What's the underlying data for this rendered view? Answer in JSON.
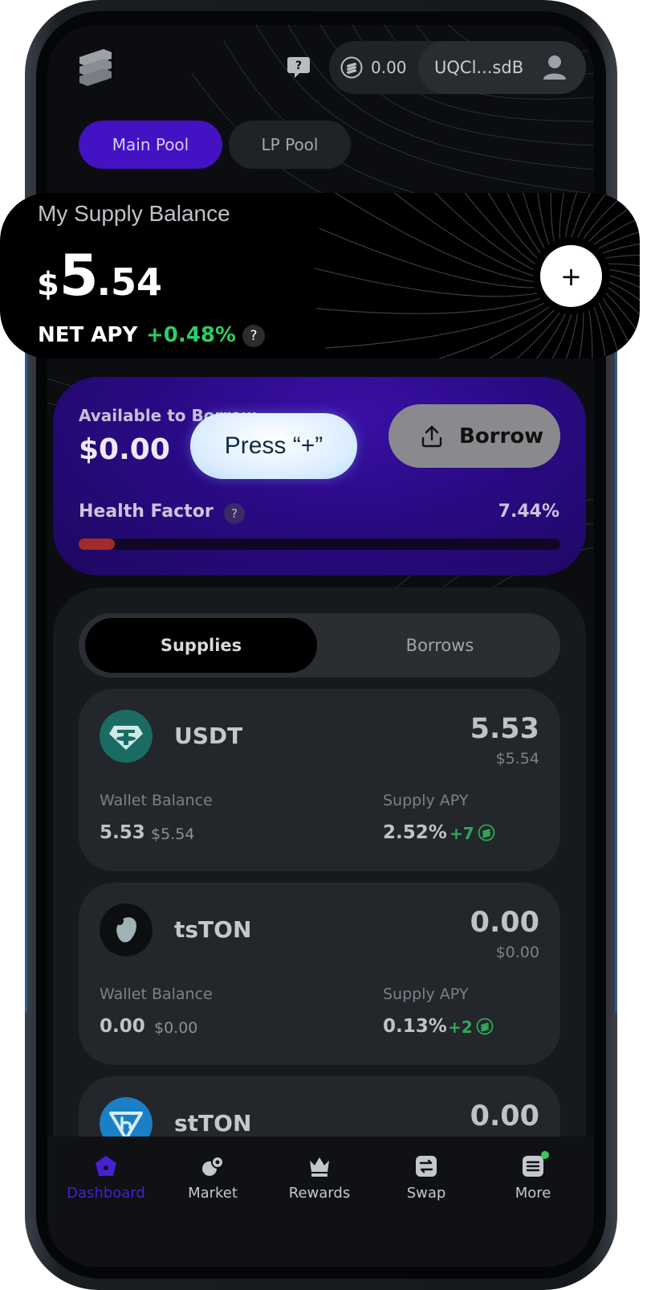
{
  "header": {
    "balance": "0.00",
    "wallet_address": "UQCl...sdB"
  },
  "pool_tabs": [
    {
      "label": "Main Pool",
      "active": true
    },
    {
      "label": "LP Pool",
      "active": false
    }
  ],
  "supply_balance": {
    "title": "My Supply Balance",
    "currency_symbol": "$",
    "value_integer": "5",
    "value_fraction": ".54",
    "net_apy_label": "NET APY",
    "net_apy_value": "+0.48%",
    "help_glyph": "?",
    "add_glyph": "+"
  },
  "borrow": {
    "available_label": "Available to Borrow",
    "available_value": "$0.00",
    "button_label": "Borrow",
    "health_label": "Health Factor",
    "health_help": "?",
    "health_value": "7.44%",
    "health_progress": 0.0744
  },
  "tooltip": {
    "text": "Press “+”"
  },
  "list_tabs": {
    "supplies": "Supplies",
    "borrows": "Borrows",
    "active": "supplies"
  },
  "assets": [
    {
      "name": "USDT",
      "amount": "5.53",
      "amount_usd": "$5.54",
      "wallet_label": "Wallet Balance",
      "wallet_amount": "5.53",
      "wallet_usd": "$5.54",
      "apy_label": "Supply APY",
      "apy_value": "2.52%",
      "apy_bonus": "+7",
      "icon": "usdt-icon"
    },
    {
      "name": "tsTON",
      "amount": "0.00",
      "amount_usd": "$0.00",
      "wallet_label": "Wallet Balance",
      "wallet_amount": "0.00",
      "wallet_usd": "$0.00",
      "apy_label": "Supply APY",
      "apy_value": "0.13%",
      "apy_bonus": "+2",
      "icon": "tston-icon"
    },
    {
      "name": "stTON",
      "amount": "0.00",
      "icon": "ston-icon"
    }
  ],
  "nav": [
    {
      "label": "Dashboard",
      "icon": "dashboard-icon",
      "active": true
    },
    {
      "label": "Market",
      "icon": "market-icon",
      "active": false
    },
    {
      "label": "Rewards",
      "icon": "crown-icon",
      "active": false
    },
    {
      "label": "Swap",
      "icon": "swap-icon",
      "active": false
    },
    {
      "label": "More",
      "icon": "more-icon",
      "active": false,
      "badge": true
    }
  ],
  "colors": {
    "accent": "#4312c2",
    "positive": "#2fcc63",
    "health_bar": "#a32a2a",
    "panel": "#16191d"
  }
}
